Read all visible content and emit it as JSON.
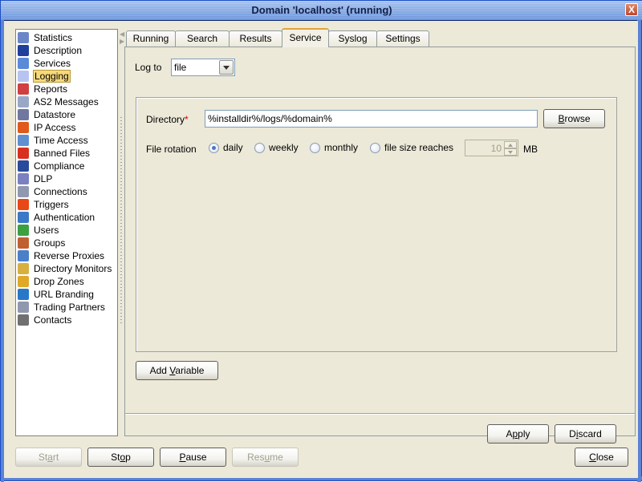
{
  "window": {
    "title": "Domain 'localhost' (running)",
    "close_glyph": "X"
  },
  "sidebar": {
    "items": [
      {
        "label": "Statistics",
        "icon": "statistics-icon",
        "color": "#6b86c8"
      },
      {
        "label": "Description",
        "icon": "person-icon",
        "color": "#1f3f9c"
      },
      {
        "label": "Services",
        "icon": "services-icon",
        "color": "#5a8ad8"
      },
      {
        "label": "Logging",
        "icon": "speech-bubble-icon",
        "color": "#b8c4f0",
        "selected": true
      },
      {
        "label": "Reports",
        "icon": "bar-chart-icon",
        "color": "#d04040"
      },
      {
        "label": "AS2 Messages",
        "icon": "messages-icon",
        "color": "#9aa8c8"
      },
      {
        "label": "Datastore",
        "icon": "database-icon",
        "color": "#7078a0"
      },
      {
        "label": "IP Access",
        "icon": "firewall-icon",
        "color": "#e05a1c"
      },
      {
        "label": "Time Access",
        "icon": "clock-icon",
        "color": "#6090d0"
      },
      {
        "label": "Banned Files",
        "icon": "banned-file-icon",
        "color": "#d83020"
      },
      {
        "label": "Compliance",
        "icon": "officer-icon",
        "color": "#2a4a9c"
      },
      {
        "label": "DLP",
        "icon": "shield-icon",
        "color": "#7a80c0"
      },
      {
        "label": "Connections",
        "icon": "gear-icon",
        "color": "#9098b0"
      },
      {
        "label": "Triggers",
        "icon": "trigger-icon",
        "color": "#e84818"
      },
      {
        "label": "Authentication",
        "icon": "id-card-icon",
        "color": "#3a78c8"
      },
      {
        "label": "Users",
        "icon": "user-icon",
        "color": "#3aa040"
      },
      {
        "label": "Groups",
        "icon": "group-icon",
        "color": "#c06030"
      },
      {
        "label": "Reverse Proxies",
        "icon": "network-icon",
        "color": "#4a80c8"
      },
      {
        "label": "Directory Monitors",
        "icon": "folder-monitor-icon",
        "color": "#d8b040"
      },
      {
        "label": "Drop Zones",
        "icon": "box-icon",
        "color": "#e0a828"
      },
      {
        "label": "URL Branding",
        "icon": "globe-icon",
        "color": "#2878c8"
      },
      {
        "label": "Trading Partners",
        "icon": "gear-icon",
        "color": "#9098b0"
      },
      {
        "label": "Contacts",
        "icon": "address-book-icon",
        "color": "#707070"
      }
    ]
  },
  "tabs": [
    {
      "label": "Running"
    },
    {
      "label": "Search"
    },
    {
      "label": "Results"
    },
    {
      "label": "Service",
      "active": true
    },
    {
      "label": "Syslog"
    },
    {
      "label": "Settings"
    }
  ],
  "service": {
    "log_to_label": "Log to",
    "log_to_value": "file",
    "directory_label": "Directory",
    "required_mark": "*",
    "directory_value": "%installdir%/logs/%domain%",
    "browse_mnemonic": "B",
    "browse_rest": "rowse",
    "file_rotation_label": "File rotation",
    "rotation_options": [
      {
        "label": "daily",
        "checked": true
      },
      {
        "label": "weekly",
        "checked": false
      },
      {
        "label": "monthly",
        "checked": false
      },
      {
        "label": "file size reaches",
        "checked": false
      }
    ],
    "file_size_value": "10",
    "file_size_unit": "MB",
    "add_variable_pre": "Add ",
    "add_variable_mnemonic": "V",
    "add_variable_rest": "ariable",
    "apply_pre": "A",
    "apply_mnemonic": "p",
    "apply_rest": "ply",
    "discard_pre": "D",
    "discard_mnemonic": "i",
    "discard_rest": "scard"
  },
  "footer": {
    "start": {
      "pre": "St",
      "mn": "a",
      "rest": "rt",
      "disabled": true
    },
    "stop": {
      "pre": "St",
      "mn": "o",
      "rest": "p",
      "disabled": false
    },
    "pause": {
      "pre": "",
      "mn": "P",
      "rest": "ause",
      "disabled": false
    },
    "resume": {
      "pre": "Res",
      "mn": "u",
      "rest": "me",
      "disabled": true
    },
    "close": {
      "pre": "",
      "mn": "C",
      "rest": "lose",
      "disabled": false
    }
  }
}
